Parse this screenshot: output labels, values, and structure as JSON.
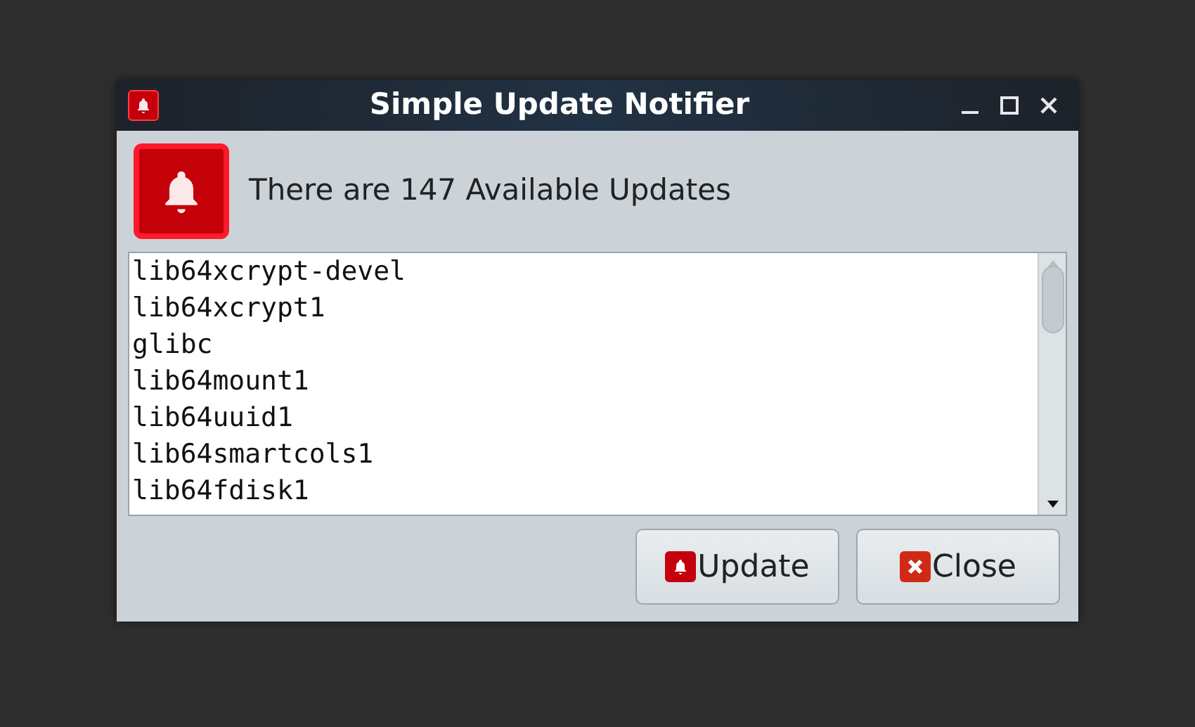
{
  "window": {
    "title": "Simple Update Notifier"
  },
  "message": "There are 147 Available Updates",
  "packages": [
    "lib64xcrypt-devel",
    "lib64xcrypt1",
    "glibc",
    "lib64mount1",
    "lib64uuid1",
    "lib64smartcols1",
    "lib64fdisk1"
  ],
  "buttons": [
    {
      "label": "Update",
      "kind": "update"
    },
    {
      "label": "Close",
      "kind": "close"
    }
  ]
}
